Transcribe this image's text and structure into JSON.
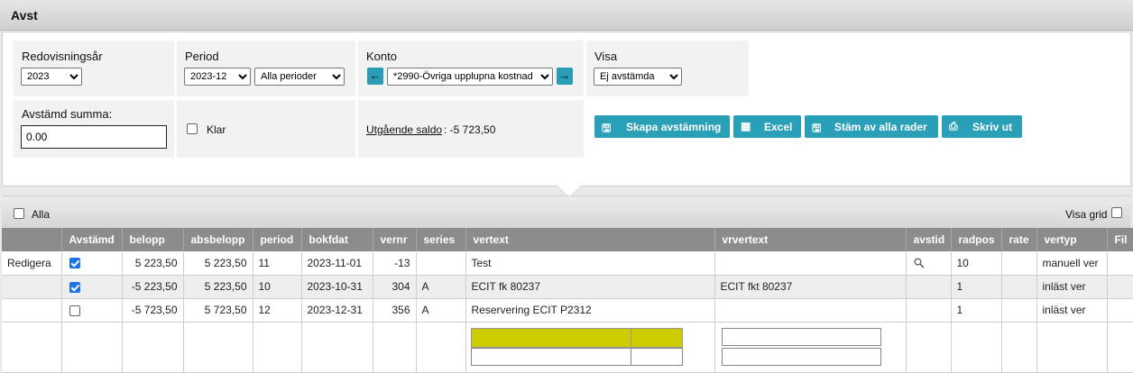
{
  "title": "Avst",
  "filters": {
    "year_label": "Redovisningsår",
    "year_value": "2023",
    "period_label": "Period",
    "period_value": "2023-12",
    "period_range": "Alla perioder",
    "konto_label": "Konto",
    "konto_value": "*2990-Övriga upplupna kostnad",
    "visa_label": "Visa",
    "visa_value": "Ej avstämda",
    "sum_label": "Avstämd summa:",
    "sum_value": "0.00",
    "klar_label": "Klar",
    "saldo_link": "Utgående saldo",
    "saldo_value": ": -5 723,50"
  },
  "actions": {
    "create": "Skapa avstämning",
    "excel": "Excel",
    "all_rows": "Stäm av alla rader",
    "print": "Skriv ut"
  },
  "grid": {
    "alla_label": "Alla",
    "visa_grid_label": "Visa grid",
    "columns": [
      "",
      "Avstämd",
      "belopp",
      "absbelopp",
      "period",
      "bokfdat",
      "vernr",
      "series",
      "vertext",
      "vrvertext",
      "avstid",
      "radpos",
      "rate",
      "vertyp",
      "Fil"
    ],
    "rows": [
      {
        "action": "Redigera",
        "checked": true,
        "belopp": "5 223,50",
        "absbelopp": "5 223,50",
        "period": "11",
        "bokfdat": "2023-11-01",
        "vernr": "-13",
        "series": "",
        "vertext": "Test",
        "vrvertext": "",
        "avstid_icon": "magnifier-icon",
        "radpos": "10",
        "rate": "",
        "vertyp": "manuell ver",
        "fil": ""
      },
      {
        "action": "",
        "checked": true,
        "belopp": "-5 223,50",
        "absbelopp": "5 223,50",
        "period": "10",
        "bokfdat": "2023-10-31",
        "vernr": "304",
        "series": "A",
        "vertext": "ECIT fk 80237",
        "vrvertext": "ECIT fkt 80237",
        "avstid_icon": "",
        "radpos": "1",
        "rate": "",
        "vertyp": "inläst ver",
        "fil": ""
      },
      {
        "action": "",
        "checked": false,
        "belopp": "-5 723,50",
        "absbelopp": "5 723,50",
        "period": "12",
        "bokfdat": "2023-12-31",
        "vernr": "356",
        "series": "A",
        "vertext": "Reservering ECIT P2312",
        "vrvertext": "",
        "avstid_icon": "",
        "radpos": "1",
        "rate": "",
        "vertyp": "inläst ver",
        "fil": ""
      }
    ]
  },
  "colors": {
    "accent": "#2aa0b8",
    "header_bg": "#8c8c8c",
    "highlight": "#cccc00"
  }
}
